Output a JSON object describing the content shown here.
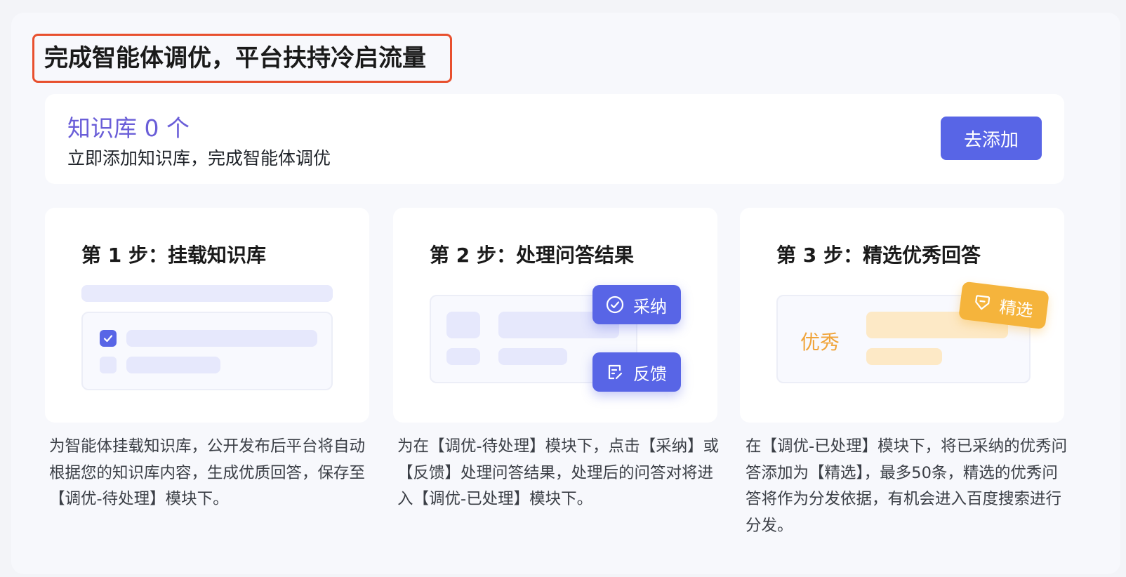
{
  "header": {
    "title": "完成智能体调优，平台扶持冷启流量"
  },
  "knowledge": {
    "count_label": "知识库 0 个",
    "subtitle": "立即添加知识库，完成智能体调优",
    "add_button": "去添加"
  },
  "steps": [
    {
      "title": "第 1 步：挂载知识库",
      "description": "为智能体挂载知识库，公开发布后平台将自动根据您的知识库内容，生成优质回答，保存至【调优-待处理】模块下。"
    },
    {
      "title": "第 2 步：处理问答结果",
      "description": "为在【调优-待处理】模块下，点击【采纳】或【反馈】处理问答结果，处理后的问答对将进入【调优-已处理】模块下。",
      "adopt_label": "采纳",
      "feedback_label": "反馈"
    },
    {
      "title": "第 3 步：精选优秀回答",
      "description": "在【调优-已处理】模块下，将已采纳的优秀问答添加为【精选】，最多50条，精选的优秀问答将作为分发依据，有机会进入百度搜索进行分发。",
      "excellent_label": "优秀",
      "featured_label": "精选"
    }
  ],
  "colors": {
    "accent": "#5865e6",
    "highlight": "#e8502e",
    "gold": "#f5b43c",
    "purple": "#6a5ed8"
  }
}
